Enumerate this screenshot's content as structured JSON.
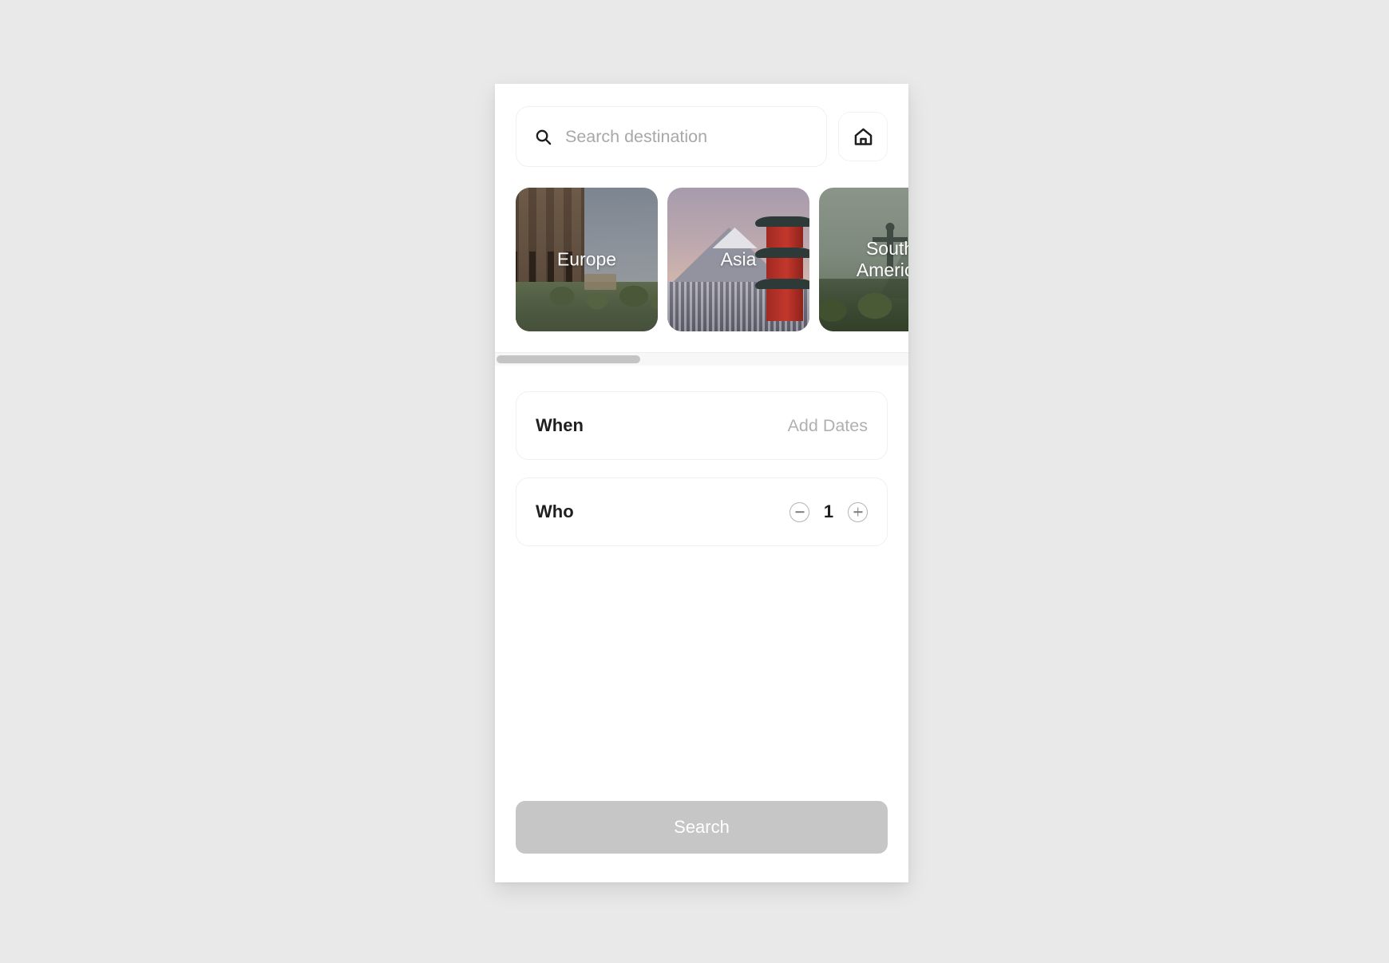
{
  "search": {
    "placeholder": "Search destination",
    "value": "",
    "icon": "search-icon",
    "home_icon": "home-icon"
  },
  "destinations": {
    "items": [
      {
        "label": "Europe",
        "art": "colosseum-photo"
      },
      {
        "label": "Asia",
        "art": "mount-fuji-pagoda-photo"
      },
      {
        "label": "South\nAmerica",
        "art": "christ-the-redeemer-photo"
      }
    ]
  },
  "options": {
    "when": {
      "label": "When",
      "value": "Add Dates"
    },
    "who": {
      "label": "Who",
      "count": "1",
      "decrement_icon": "minus-circle-icon",
      "increment_icon": "plus-circle-icon"
    }
  },
  "footer": {
    "search_label": "Search"
  },
  "colors": {
    "page_background": "#e9e9e9",
    "frame_background": "#ffffff",
    "text_primary": "#1f1f1f",
    "text_muted": "#b0b0b0",
    "button_disabled": "#c6c6c6",
    "scroll_thumb": "#c4c4c4"
  }
}
